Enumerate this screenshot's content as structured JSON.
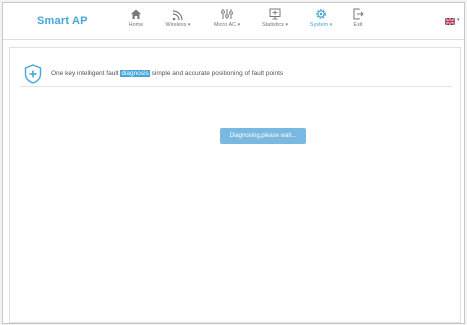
{
  "header": {
    "brand": "Smart AP",
    "nav": [
      {
        "label": "Home",
        "icon": "home-icon",
        "dropdown": false
      },
      {
        "label": "Wireless",
        "icon": "wifi-icon",
        "dropdown": true
      },
      {
        "label": "Micro AC",
        "icon": "sliders-icon",
        "dropdown": true
      },
      {
        "label": "Statistics",
        "icon": "monitor-icon",
        "dropdown": true
      },
      {
        "label": "System",
        "icon": "gear-icon",
        "dropdown": true
      },
      {
        "label": "Exit",
        "icon": "exit-icon",
        "dropdown": false
      }
    ],
    "active": "System",
    "language_icon": "uk-flag-icon"
  },
  "main": {
    "text_before": "One key intelligent fault ",
    "text_highlight": "diagnosis",
    "text_after": " simple and accurate positioning of fault points",
    "status": "Diagnosing,please wait..."
  },
  "colors": {
    "accent": "#46a6d9",
    "status_button": "#79b8e0"
  }
}
